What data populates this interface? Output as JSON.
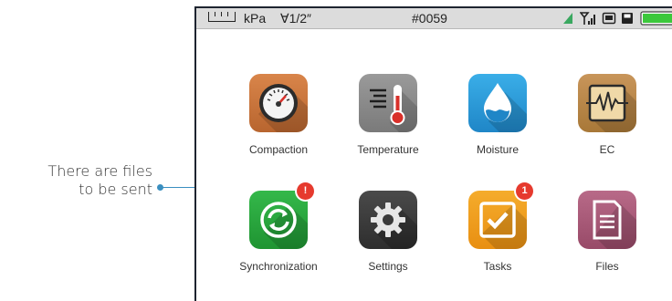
{
  "callout": {
    "line1": "There are files",
    "line2": "to be sent"
  },
  "status_bar": {
    "unit": "kPa",
    "depth": "∀1/2″",
    "device_id": "#0059",
    "battery_color": "#3cc83c"
  },
  "apps": [
    {
      "label": "Compaction",
      "icon": "gauge-icon",
      "color": "#c9753e"
    },
    {
      "label": "Temperature",
      "icon": "thermometer-icon",
      "color": "#8a8a8a"
    },
    {
      "label": "Moisture",
      "icon": "water-drop-icon",
      "color": "#2e9fdc"
    },
    {
      "label": "EC",
      "icon": "waveform-icon",
      "color": "#b8874a"
    },
    {
      "label": "Synchronization",
      "icon": "sync-icon",
      "color": "#2aa63c",
      "badge": "!"
    },
    {
      "label": "Settings",
      "icon": "gear-icon",
      "color": "#3a3a3a"
    },
    {
      "label": "Tasks",
      "icon": "checkbox-icon",
      "color": "#f0a020",
      "badge": "1"
    },
    {
      "label": "Files",
      "icon": "document-icon",
      "color": "#a85a78"
    }
  ]
}
